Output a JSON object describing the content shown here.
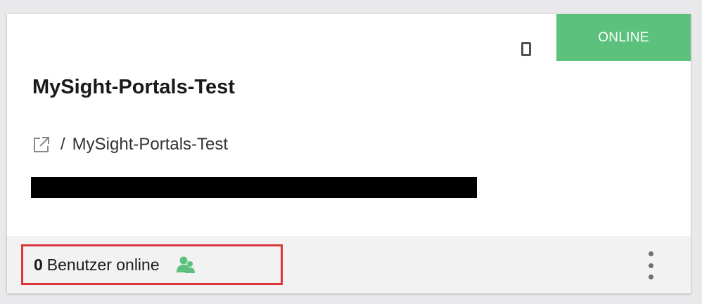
{
  "card": {
    "status": "ONLINE",
    "title": "MySight-Portals-Test",
    "link_separator": "/",
    "link_path": "MySight-Portals-Test",
    "device_icon": "mobile-device-icon",
    "external_link_icon": "external-link-icon"
  },
  "footer": {
    "users_count": "0",
    "users_label": "Benutzer online",
    "users_icon": "users-icon",
    "more_icon": "more-vertical-icon"
  },
  "colors": {
    "online": "#5cc17c",
    "highlight_border": "#d9363e",
    "footer_bg": "#f2f2f2",
    "page_bg": "#e9e9eb"
  }
}
